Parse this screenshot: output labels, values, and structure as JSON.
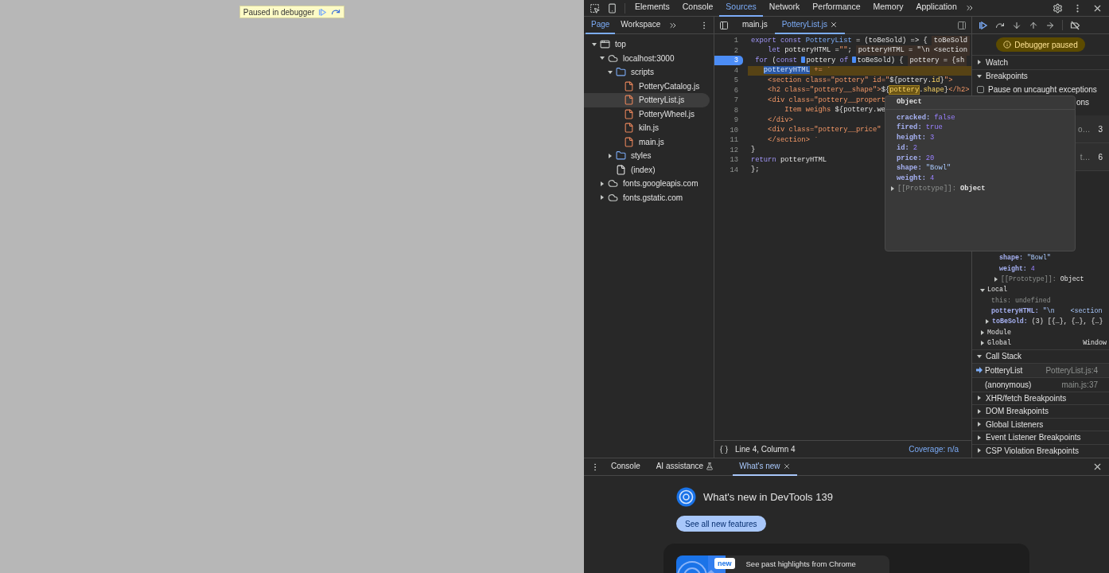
{
  "page": {
    "badge": "Paused in debugger"
  },
  "toolbar": {
    "tabs": [
      {
        "label": "Elements",
        "selected": false
      },
      {
        "label": "Console",
        "selected": false
      },
      {
        "label": "Sources",
        "selected": true
      },
      {
        "label": "Network",
        "selected": false
      },
      {
        "label": "Performance",
        "selected": false
      },
      {
        "label": "Memory",
        "selected": false
      },
      {
        "label": "Application",
        "selected": false
      }
    ]
  },
  "navigator": {
    "tabs": [
      {
        "label": "Page",
        "selected": true
      },
      {
        "label": "Workspace",
        "selected": false
      }
    ],
    "tree": [
      {
        "label": "top",
        "kind": "frame",
        "expanded": true,
        "selected": false,
        "children": [
          {
            "label": "localhost:3000",
            "kind": "origin",
            "expanded": true,
            "selected": false,
            "children": [
              {
                "label": "scripts",
                "kind": "folder",
                "expanded": true,
                "selected": false,
                "children": [
                  {
                    "label": "PotteryCatalog.js",
                    "kind": "script",
                    "selected": false
                  },
                  {
                    "label": "PotteryList.js",
                    "kind": "script",
                    "selected": true
                  },
                  {
                    "label": "PotteryWheel.js",
                    "kind": "script",
                    "selected": false
                  },
                  {
                    "label": "kiln.js",
                    "kind": "script",
                    "selected": false
                  },
                  {
                    "label": "main.js",
                    "kind": "script",
                    "selected": false
                  }
                ]
              },
              {
                "label": "styles",
                "kind": "folder",
                "expanded": false,
                "selected": false
              },
              {
                "label": "(index)",
                "kind": "document",
                "selected": false
              }
            ]
          },
          {
            "label": "fonts.googleapis.com",
            "kind": "origin",
            "expanded": false,
            "selected": false
          },
          {
            "label": "fonts.gstatic.com",
            "kind": "origin",
            "expanded": false,
            "selected": false
          }
        ]
      }
    ]
  },
  "editor": {
    "tabs": [
      {
        "label": "main.js",
        "selected": false,
        "closable": false
      },
      {
        "label": "PotteryList.js",
        "selected": true,
        "closable": true
      }
    ],
    "lines": [
      {
        "number": "1",
        "breakpoint": false,
        "current": false,
        "tokens": [
          {
            "kind": "kw",
            "text": "export const "
          },
          {
            "kind": "def",
            "text": "PotteryList"
          },
          {
            "kind": "plain",
            "text": " = (toBeSold) => {"
          }
        ],
        "inline": "toBeSold"
      },
      {
        "number": "2",
        "breakpoint": false,
        "current": false,
        "tokens": [
          {
            "kind": "kw",
            "text": "    let "
          },
          {
            "kind": "plain",
            "text": "potteryHTML ="
          },
          {
            "kind": "str",
            "text": "\"\""
          },
          {
            "kind": "plain",
            "text": ";"
          }
        ],
        "inline": "potteryHTML = \"\\n <section"
      },
      {
        "number": "3",
        "breakpoint": true,
        "current": false,
        "tokens": [
          {
            "kind": "kw",
            "text": " for "
          },
          {
            "kind": "plain",
            "text": "("
          },
          {
            "kind": "kw",
            "text": "const "
          },
          {
            "kind": "marker"
          },
          {
            "kind": "plain",
            "text": "pottery "
          },
          {
            "kind": "kw",
            "text": "of "
          },
          {
            "kind": "marker"
          },
          {
            "kind": "plain",
            "text": "toBeSold) {"
          }
        ],
        "inline": "pottery = {sh"
      },
      {
        "number": "4",
        "breakpoint": false,
        "current": true,
        "tokens": [
          {
            "kind": "sel",
            "text": "   potteryHTML"
          },
          {
            "kind": "str",
            "text": " += `"
          }
        ]
      },
      {
        "number": "5",
        "breakpoint": false,
        "current": false,
        "tokens": [
          {
            "kind": "str",
            "text": "    <section class=\"pottery\" id=\""
          },
          {
            "kind": "plain",
            "text": "${pottery."
          },
          {
            "kind": "prop",
            "text": "id"
          },
          {
            "kind": "plain",
            "text": "}"
          },
          {
            "kind": "str",
            "text": "\">"
          }
        ]
      },
      {
        "number": "6",
        "breakpoint": false,
        "current": false,
        "tokens": [
          {
            "kind": "str",
            "text": "    <h2 class=\"pottery__shape\">"
          },
          {
            "kind": "plain",
            "text": "${"
          },
          {
            "kind": "hover",
            "text": "pottery"
          },
          {
            "kind": "plain",
            "text": "."
          },
          {
            "kind": "prop",
            "text": "shape"
          },
          {
            "kind": "plain",
            "text": "}"
          },
          {
            "kind": "str",
            "text": "</h2>"
          }
        ]
      },
      {
        "number": "7",
        "breakpoint": false,
        "current": false,
        "tokens": [
          {
            "kind": "str",
            "text": "    <div class=\"pottery__propert"
          }
        ]
      },
      {
        "number": "8",
        "breakpoint": false,
        "current": false,
        "tokens": [
          {
            "kind": "str",
            "text": "        Item weighs "
          },
          {
            "kind": "plain",
            "text": "${pottery.we"
          }
        ]
      },
      {
        "number": "9",
        "breakpoint": false,
        "current": false,
        "tokens": [
          {
            "kind": "str",
            "text": "    </div>"
          }
        ]
      },
      {
        "number": "10",
        "breakpoint": false,
        "current": false,
        "tokens": [
          {
            "kind": "str",
            "text": "    <div class=\"pottery__price\""
          }
        ]
      },
      {
        "number": "11",
        "breakpoint": false,
        "current": false,
        "tokens": [
          {
            "kind": "str",
            "text": "    </section> `"
          }
        ]
      },
      {
        "number": "12",
        "breakpoint": false,
        "current": false,
        "tokens": [
          {
            "kind": "plain",
            "text": "}"
          }
        ]
      },
      {
        "number": "13",
        "breakpoint": false,
        "current": false,
        "tokens": [
          {
            "kind": "kw",
            "text": "return "
          },
          {
            "kind": "plain",
            "text": "potteryHTML"
          }
        ]
      },
      {
        "number": "14",
        "breakpoint": false,
        "current": false,
        "tokens": [
          {
            "kind": "plain",
            "text": "};"
          }
        ]
      }
    ],
    "status": {
      "position": "Line 4, Column 4",
      "coverage": "Coverage: n/a"
    }
  },
  "popover": {
    "title": "Object",
    "properties": [
      {
        "key": "cracked:",
        "value": "false",
        "kind": "boolean"
      },
      {
        "key": "fired:",
        "value": "true",
        "kind": "boolean"
      },
      {
        "key": "height:",
        "value": "3",
        "kind": "number"
      },
      {
        "key": "id:",
        "value": "2",
        "kind": "number"
      },
      {
        "key": "price:",
        "value": "20",
        "kind": "number"
      },
      {
        "key": "shape:",
        "value": "\"Bowl\"",
        "kind": "string"
      },
      {
        "key": "weight:",
        "value": "4",
        "kind": "number"
      }
    ],
    "prototype": {
      "key": "[[Prototype]]:",
      "value": "Object",
      "expanded": false
    }
  },
  "debugger": {
    "status": "Debugger paused",
    "watch": {
      "title": "Watch",
      "expanded": false
    },
    "breakpoints": {
      "title": "Breakpoints",
      "expanded": true,
      "options": [
        {
          "label": "Pause on uncaught exceptions",
          "checked": false
        }
      ],
      "partial_option": "ons",
      "partial_rows": [
        {
          "text": "o…",
          "line": "3"
        },
        {
          "text": "t…",
          "line": "6"
        }
      ]
    },
    "scope": {
      "continued": [
        {
          "key": "shape:",
          "value": "\"Bowl\"",
          "kind": "string"
        },
        {
          "key": "weight:",
          "value": "4",
          "kind": "number"
        },
        {
          "key": "[[Prototype]]:",
          "value": "Object",
          "kind": "object",
          "expanded": false
        }
      ],
      "sections": [
        {
          "title": "Local",
          "expanded": true,
          "children": [
            {
              "key": "this:",
              "value": "undefined",
              "kind": "undefined"
            },
            {
              "key": "potteryHTML:",
              "value": "\"\\n    <section",
              "kind": "string"
            },
            {
              "key": "toBeSold:",
              "value": "(3) [{…}, {…}, {…}",
              "kind": "array",
              "expanded": false
            }
          ]
        },
        {
          "title": "Module",
          "expanded": false
        },
        {
          "title": "Global",
          "expanded": false,
          "value": "Window"
        }
      ]
    },
    "call_stack": {
      "title": "Call Stack",
      "expanded": true,
      "frames": [
        {
          "name": "PotteryList",
          "location": "PotteryList.js:4",
          "selected": true
        },
        {
          "name": "(anonymous)",
          "location": "main.js:37",
          "selected": false
        }
      ]
    },
    "panes": [
      {
        "title": "XHR/fetch Breakpoints",
        "expanded": false
      },
      {
        "title": "DOM Breakpoints",
        "expanded": false
      },
      {
        "title": "Global Listeners",
        "expanded": false
      },
      {
        "title": "Event Listener Breakpoints",
        "expanded": false
      },
      {
        "title": "CSP Violation Breakpoints",
        "expanded": false
      }
    ]
  },
  "drawer": {
    "tabs": [
      {
        "label": "Console",
        "selected": false,
        "kind": "plain"
      },
      {
        "label": "AI assistance",
        "selected": false,
        "kind": "experimental"
      },
      {
        "label": "What's new",
        "selected": true,
        "kind": "closable"
      }
    ],
    "title": "What's new in DevTools 139",
    "button": "See all new features",
    "card": {
      "badge": "new",
      "text": "See past highlights from Chrome"
    }
  }
}
